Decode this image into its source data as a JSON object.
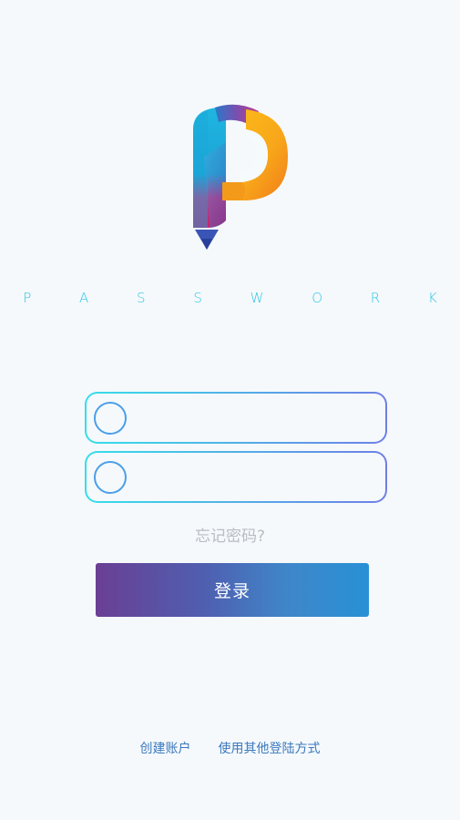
{
  "app": {
    "brand": "P A S S W O R K"
  },
  "form": {
    "username": {
      "value": "",
      "placeholder": ""
    },
    "password": {
      "value": "",
      "placeholder": ""
    },
    "forgot_label": "忘记密码?",
    "login_label": "登录"
  },
  "footer": {
    "create_account": "创建账户",
    "other_login": "使用其他登陆方式"
  },
  "colors": {
    "background": "#f5f9fc",
    "brand_text": "#2bc7e6",
    "field_border_start": "#35dfe8",
    "field_border_end": "#6f7fe6",
    "button_start": "#6a3f94",
    "button_end": "#2891d6",
    "link": "#3b78bd",
    "muted": "#b9bcc0"
  },
  "icons": {
    "logo": "passwork-p-logo-icon",
    "field_icon": "circle-icon"
  }
}
